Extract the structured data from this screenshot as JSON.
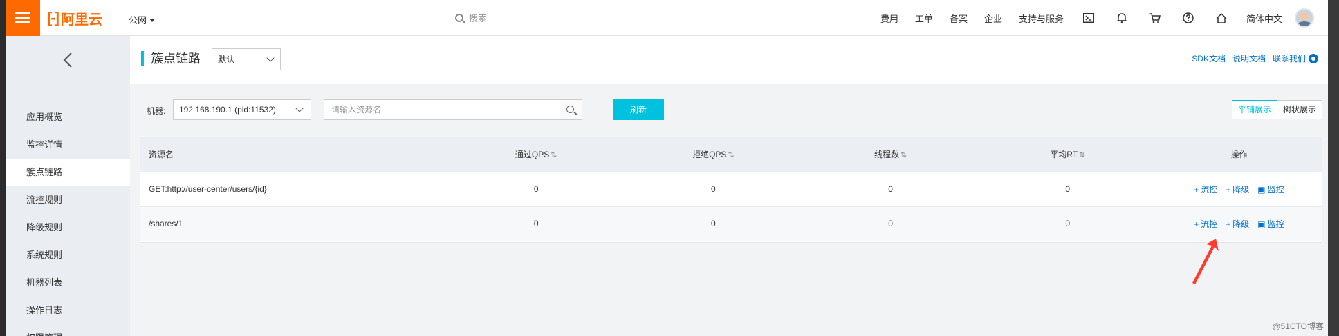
{
  "topbar": {
    "logo": "阿里云",
    "logo_mark": "[-]",
    "region": "公网",
    "search_placeholder": "搜索",
    "links": [
      "费用",
      "工单",
      "备案",
      "企业",
      "支持与服务"
    ],
    "language": "简体中文"
  },
  "sidebar": {
    "items": [
      {
        "label": "应用概览"
      },
      {
        "label": "监控详情"
      },
      {
        "label": "簇点链路"
      },
      {
        "label": "流控规则"
      },
      {
        "label": "降级规则"
      },
      {
        "label": "系统规则"
      },
      {
        "label": "机器列表"
      },
      {
        "label": "操作日志"
      },
      {
        "label": "权限管理"
      }
    ]
  },
  "header": {
    "title": "簇点链路",
    "select_value": "默认",
    "links": [
      "SDK文档",
      "说明文档",
      "联系我们"
    ]
  },
  "toolbar": {
    "machine_label": "机器:",
    "machine_value": "192.168.190.1 (pid:11532)",
    "resource_placeholder": "请输入资源名",
    "refresh_label": "刷新",
    "view_flat": "平铺展示",
    "view_tree": "树状展示"
  },
  "table": {
    "headers": {
      "resource": "资源名",
      "pass_qps": "通过QPS",
      "block_qps": "拒绝QPS",
      "threads": "线程数",
      "avg_rt": "平均RT",
      "ops": "操作"
    },
    "rows": [
      {
        "resource": "GET:http://user-center/users/{id}",
        "pass_qps": "0",
        "block_qps": "0",
        "threads": "0",
        "avg_rt": "0"
      },
      {
        "resource": "/shares/1",
        "pass_qps": "0",
        "block_qps": "0",
        "threads": "0",
        "avg_rt": "0"
      }
    ],
    "op_labels": {
      "flow": "流控",
      "degrade": "降级",
      "monitor": "监控"
    }
  },
  "watermark": "@51CTO博客",
  "colors": {
    "accent": "#00c1de",
    "brand": "#ff6a00",
    "link": "#0070cc",
    "arrow": "#ff3b30"
  }
}
